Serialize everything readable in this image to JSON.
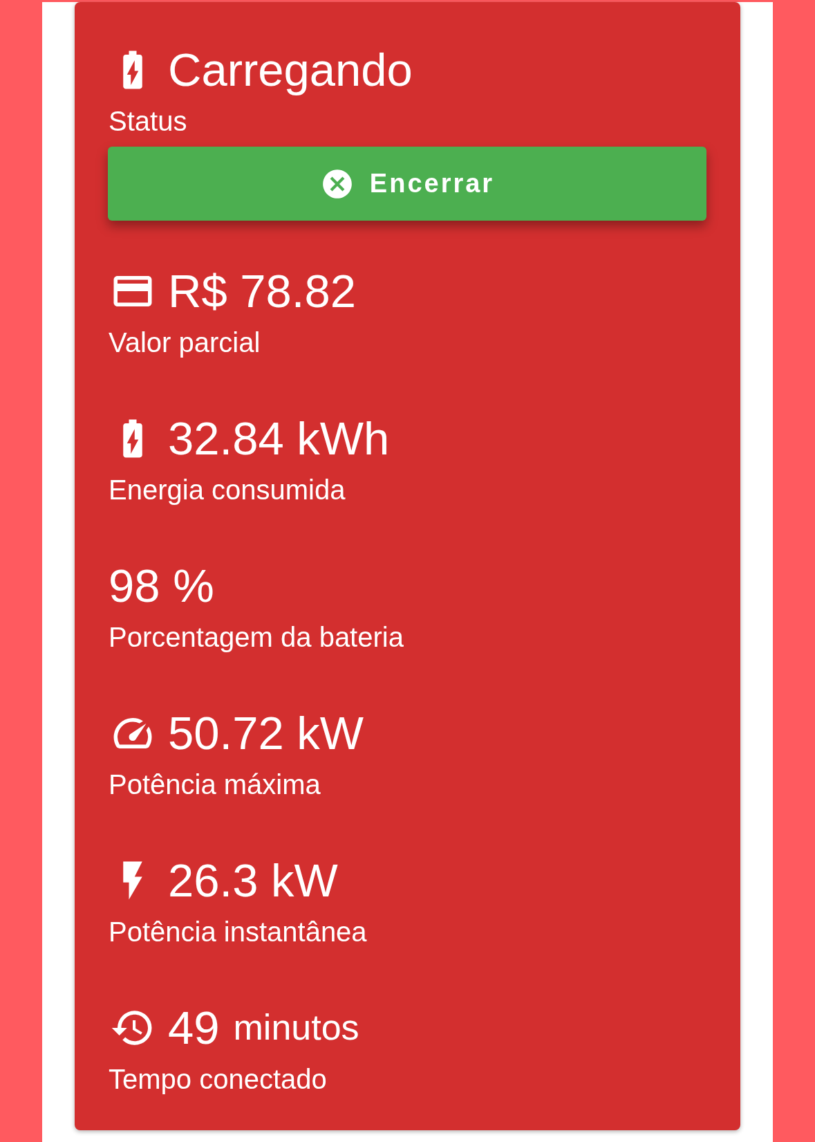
{
  "status": {
    "kind": "battery-charging",
    "value": "Carregando",
    "label": "Status"
  },
  "end_button": {
    "label": "Encerrar"
  },
  "metrics": [
    {
      "kind": "card",
      "value": "R$ 78.82",
      "label": "Valor parcial"
    },
    {
      "kind": "battery-charging",
      "value": "32.84 kWh",
      "label": "Energia consumida"
    },
    {
      "kind": "plain",
      "value": "98 %",
      "label": "Porcentagem da bateria"
    },
    {
      "kind": "gauge",
      "value": "50.72 kW",
      "label": "Potência máxima"
    },
    {
      "kind": "bolt",
      "value": "26.3 kW",
      "label": "Potência instantânea"
    },
    {
      "kind": "history",
      "value": "49",
      "unit": "minutos",
      "label": "Tempo conectado"
    }
  ]
}
